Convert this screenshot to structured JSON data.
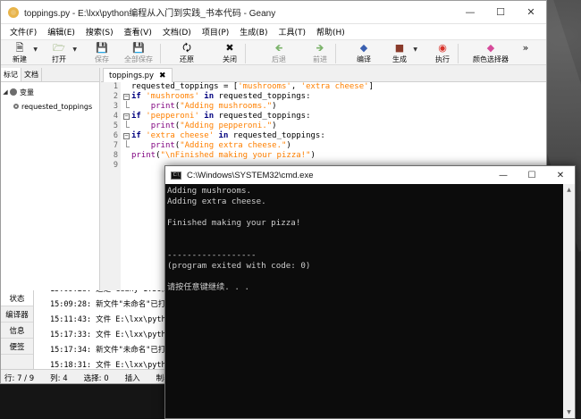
{
  "geany": {
    "title": "toppings.py - E:\\lxx\\python编程从入门到实践_书本代码 - Geany",
    "menu": [
      "文件(F)",
      "编辑(E)",
      "搜索(S)",
      "查看(V)",
      "文档(D)",
      "项目(P)",
      "生成(B)",
      "工具(T)",
      "帮助(H)"
    ],
    "toolbar": {
      "new": "新建",
      "open": "打开",
      "save": "保存",
      "save_all": "全部保存",
      "revert": "还原",
      "close": "关闭",
      "back": "后退",
      "forward": "前进",
      "compile": "编译",
      "build": "生成",
      "execute": "执行",
      "color": "颜色选择器",
      "more": "»"
    },
    "sidebar": {
      "tabs": [
        "标记",
        "文档"
      ],
      "tree": [
        {
          "label": "变量"
        },
        {
          "label": "requested_toppings"
        }
      ]
    },
    "editor": {
      "tab_label": "toppings.py",
      "line_numbers": [
        "1",
        "2",
        "3",
        "4",
        "5",
        "6",
        "7",
        "8",
        "9"
      ],
      "code_lines": [
        "requested_toppings = ['mushrooms', 'extra cheese']",
        "if 'mushrooms' in requested_toppings:",
        "    print(\"Adding mushrooms.\")",
        "if 'pepperoni' in requested_toppings:",
        "    print(\"Adding pepperoni.\")",
        "if 'extra cheese' in requested_toppings:",
        "    print(\"Adding extra cheese.\")",
        "print(\"\\nFinished making your pizza!\")",
        ""
      ]
    },
    "messages": {
      "tabs": [
        "状态",
        "编译器",
        "信息",
        "便签"
      ],
      "lines": [
        "15:09:28: 这是 Geany 1.36。",
        "15:09:28: 新文件\"未命名\"已打开。",
        "15:11:43: 文件 E:\\lxx\\python编程从入门到实践_书本代码",
        "15:17:33: 文件 E:\\lxx\\python编程从入门到实践_书本代码",
        "15:17:34: 新文件\"未命名\"已打开。",
        "15:18:31: 文件 E:\\lxx\\python编程从入门到实践_书本代码"
      ]
    },
    "status": {
      "line": "行: 7 / 9",
      "col": "列: 4",
      "sel": "选择: 0",
      "mode": "插入",
      "tabs": "制表"
    }
  },
  "cmd": {
    "title": "C:\\Windows\\SYSTEM32\\cmd.exe",
    "lines": [
      "Adding mushrooms.",
      "Adding extra cheese.",
      "",
      "Finished making your pizza!",
      "",
      "",
      "------------------",
      "(program exited with code: 0)",
      "",
      "请按任意键继续. . ."
    ]
  }
}
